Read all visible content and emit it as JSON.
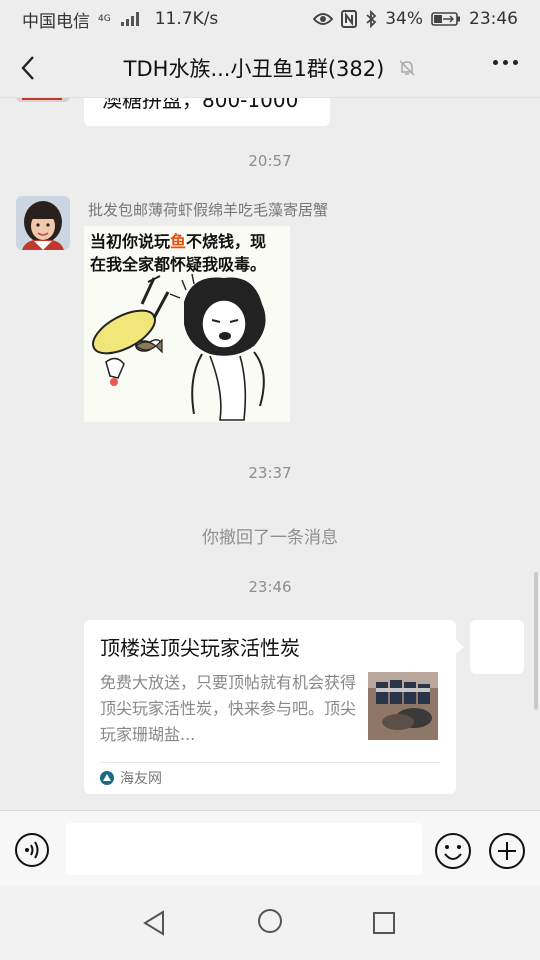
{
  "status_bar": {
    "carrier": "中国电信",
    "network_tag": "4G",
    "net_speed": "11.7K/s",
    "battery": "34%",
    "time": "23:46"
  },
  "header": {
    "title": "TDH水族...小丑鱼1群(382)"
  },
  "chat": {
    "partial_message": "澳糖拼盘，800-1000",
    "timestamps": [
      "20:57",
      "23:37",
      "23:46"
    ],
    "sender_name": "批发包邮薄荷虾假绵羊吃毛藻寄居蟹",
    "sticker": {
      "line1_before": "当初你说玩",
      "line1_highlight": "鱼",
      "line1_after": "不烧钱，现",
      "line2": "在我全家都怀疑我吸毒。"
    },
    "recall_notice": "你撤回了一条消息",
    "link_card": {
      "title": "顶楼送顶尖玩家活性炭",
      "description": "免费大放送，只要顶帖就有机会获得顶尖玩家活性炭，快来参与吧。顶尖玩家珊瑚盐...",
      "source": "海友网"
    }
  },
  "input_bar": {
    "placeholder": ""
  },
  "colors": {
    "background": "#ededed",
    "bubble": "#ffffff",
    "timestamp_text": "#8f8f8f",
    "sticker_highlight": "#e8520a"
  }
}
